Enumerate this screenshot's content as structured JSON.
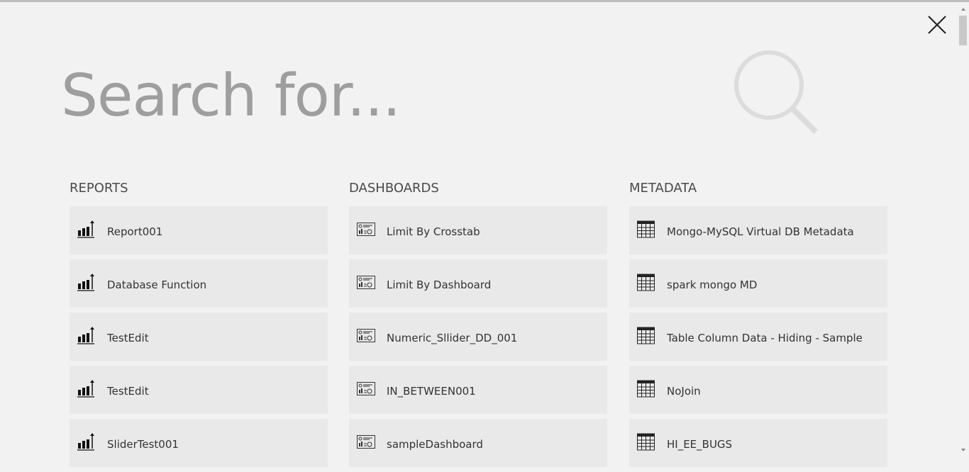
{
  "search": {
    "placeholder": "Search for..."
  },
  "reports": {
    "heading": "REPORTS",
    "items": [
      {
        "label": "Report001"
      },
      {
        "label": "Database Function"
      },
      {
        "label": "TestEdit"
      },
      {
        "label": "TestEdit"
      },
      {
        "label": "SliderTest001"
      }
    ]
  },
  "dashboards": {
    "heading": "DASHBOARDS",
    "items": [
      {
        "label": "Limit By Crosstab"
      },
      {
        "label": "Limit By Dashboard"
      },
      {
        "label": "Numeric_Sllider_DD_001"
      },
      {
        "label": "IN_BETWEEN001"
      },
      {
        "label": "sampleDashboard"
      }
    ]
  },
  "metadata": {
    "heading": "METADATA",
    "items": [
      {
        "label": "Mongo-MySQL Virtual DB Metadata"
      },
      {
        "label": "spark mongo MD"
      },
      {
        "label": "Table Column Data - Hiding - Sample"
      },
      {
        "label": "NoJoin"
      },
      {
        "label": "HI_EE_BUGS"
      }
    ]
  },
  "icons": {
    "close": "close-icon",
    "search": "search-icon",
    "report": "bar-chart-icon",
    "dashboard": "dashboard-icon",
    "metadata": "table-grid-icon"
  },
  "colors": {
    "background": "#f2f2f2",
    "item_background": "#e9e9e9",
    "placeholder_text": "#9e9e9e",
    "search_icon": "#dcdcdc"
  }
}
